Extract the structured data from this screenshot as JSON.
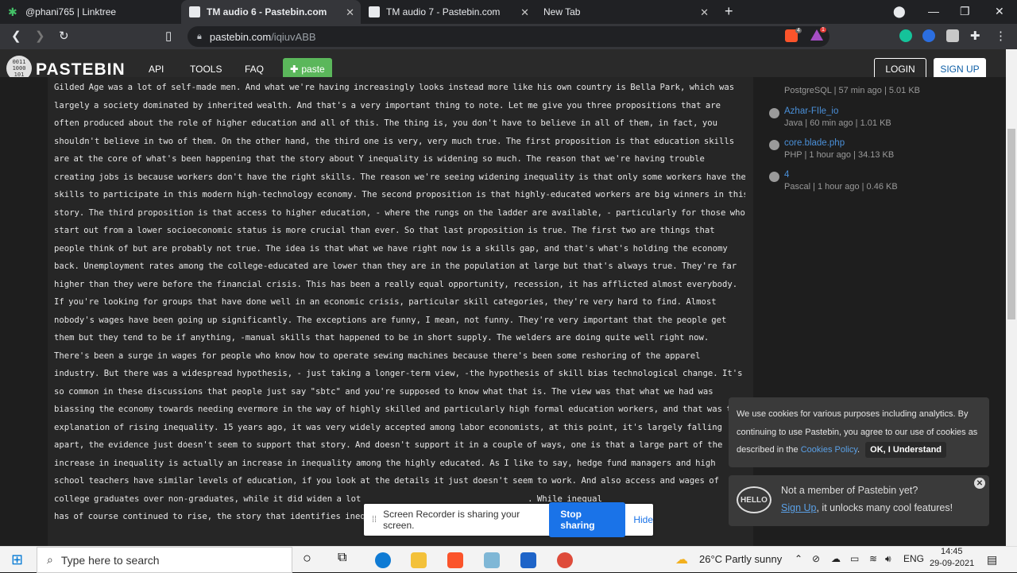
{
  "browser": {
    "tabs": [
      {
        "title": "@phani765 | Linktree",
        "color": "#43c067"
      },
      {
        "title": "TM audio 6 - Pastebin.com",
        "color": "#e8eaed"
      },
      {
        "title": "TM audio 7 - Pastebin.com",
        "color": "#e8eaed"
      },
      {
        "title": "New Tab",
        "color": ""
      }
    ],
    "new_tab_symbol": "+",
    "url_host": "pastebin.com",
    "url_path": "/iqiuvABB",
    "brave_badge": "4",
    "alert_badge": "1"
  },
  "header": {
    "logo_text": "PASTEBIN",
    "logo_binary": [
      "0011",
      "1000",
      "101"
    ],
    "nav": [
      "API",
      "TOOLS",
      "FAQ"
    ],
    "paste_button": "paste",
    "login": "LOGIN",
    "signup": "SIGN UP"
  },
  "paste_lines": [
    "Gilded Age was a lot of self-made men. And what we're having increasingly looks instead more like his own country is Bella Park, which was",
    "largely a society dominated by inherited wealth. And that's a very important thing to note. Let me give you three propositions that are",
    "often produced about the role of higher education and all of this. The thing is, you don't have to believe in all of them, in fact, you",
    "shouldn't believe in two of them. On the other hand, the third one is very, very much true. The first proposition is that education skills",
    "are at the core of what's been happening that the story about Y inequality is widening so much. The reason that we're having trouble",
    "creating jobs is because workers don't have the right skills. The reason we're seeing widening inequality is that only some workers have the",
    "skills to participate in this modern high-technology economy. The second proposition is that highly-educated workers are big winners in this",
    "story. The third proposition is that access to higher education, - where the rungs on the ladder are available, - particularly for those who",
    "start out from a lower socioeconomic status is more crucial than ever. So that last proposition is true. The first two are things that",
    "people think of but are probably not true. The idea is that what we have right now is a skills gap, and that's what's holding the economy",
    "back. Unemployment rates among the college-educated are lower than they are in the population at large but that's always true. They're far",
    "higher than they were before the financial crisis. This has been a really equal opportunity, recession, it has afflicted almost everybody.",
    "If you're looking for groups that have done well in an economic crisis, particular skill categories, they're very hard to find. Almost",
    "nobody's wages have been going up significantly. The exceptions are funny, I mean, not funny. They're very important that the people get",
    "them but they tend to be if anything, -manual skills that happened to be in short supply. The welders are doing quite well right now.",
    "There's been a surge in wages for people who know how to operate sewing machines because there's been some reshoring of the apparel",
    "industry. But there was a widespread hypothesis, - just taking a longer-term view, -the hypothesis of skill bias technological change. It's",
    "so common in these discussions that people just say \"sbtc\" and you're supposed to know what that is. The view was that what we had was",
    "biassing the economy towards needing evermore in the way of highly skilled and particularly high formal education workers, and that was th",
    "explanation of rising inequality. 15 years ago, it was very widely accepted among labor economists, at this point, it's largely falling",
    "apart, the evidence just doesn't seem to support that story. And doesn't support it in a couple of ways, one is that a large part of the",
    "increase in inequality is actually an increase in inequality among the highly educated. As I like to say, hedge fund managers and high",
    "school teachers have similar levels of education, if you look at the details it just doesn't seem to work. And also access and wages of",
    "college graduates over non-graduates, while it did widen a lot                                       . While inequal",
    "has of course continued to rise, the story that identifies ineq                                      . It has not really"
  ],
  "sidebar": {
    "first_meta": "PostgreSQL | 57 min ago | 5.01 KB",
    "items": [
      {
        "title": "Azhar-FIle_io",
        "meta": "Java | 60 min ago | 1.01 KB"
      },
      {
        "title": "core.blade.php",
        "meta": "PHP | 1 hour ago | 34.13 KB"
      },
      {
        "title": "4",
        "meta": "Pascal | 1 hour ago | 0.46 KB"
      }
    ]
  },
  "cookie": {
    "text_a": "We use cookies for various purposes including analytics. By continuing to use Pastebin, you agree to our use of cookies as described in the ",
    "link": "Cookies Policy",
    "text_b": ".",
    "ok": "OK, I Understand"
  },
  "member": {
    "hello": "HELLO",
    "line1": "Not a member of Pastebin yet?",
    "signup_link": "Sign Up",
    "line2": ", it unlocks many cool features!"
  },
  "recorder": {
    "message": "Screen Recorder is sharing your screen.",
    "stop": "Stop sharing",
    "hide": "Hide"
  },
  "taskbar": {
    "search_placeholder": "Type here to search",
    "weather": "26°C  Partly sunny",
    "lang": "ENG",
    "time": "14:45",
    "date": "29-09-2021"
  }
}
